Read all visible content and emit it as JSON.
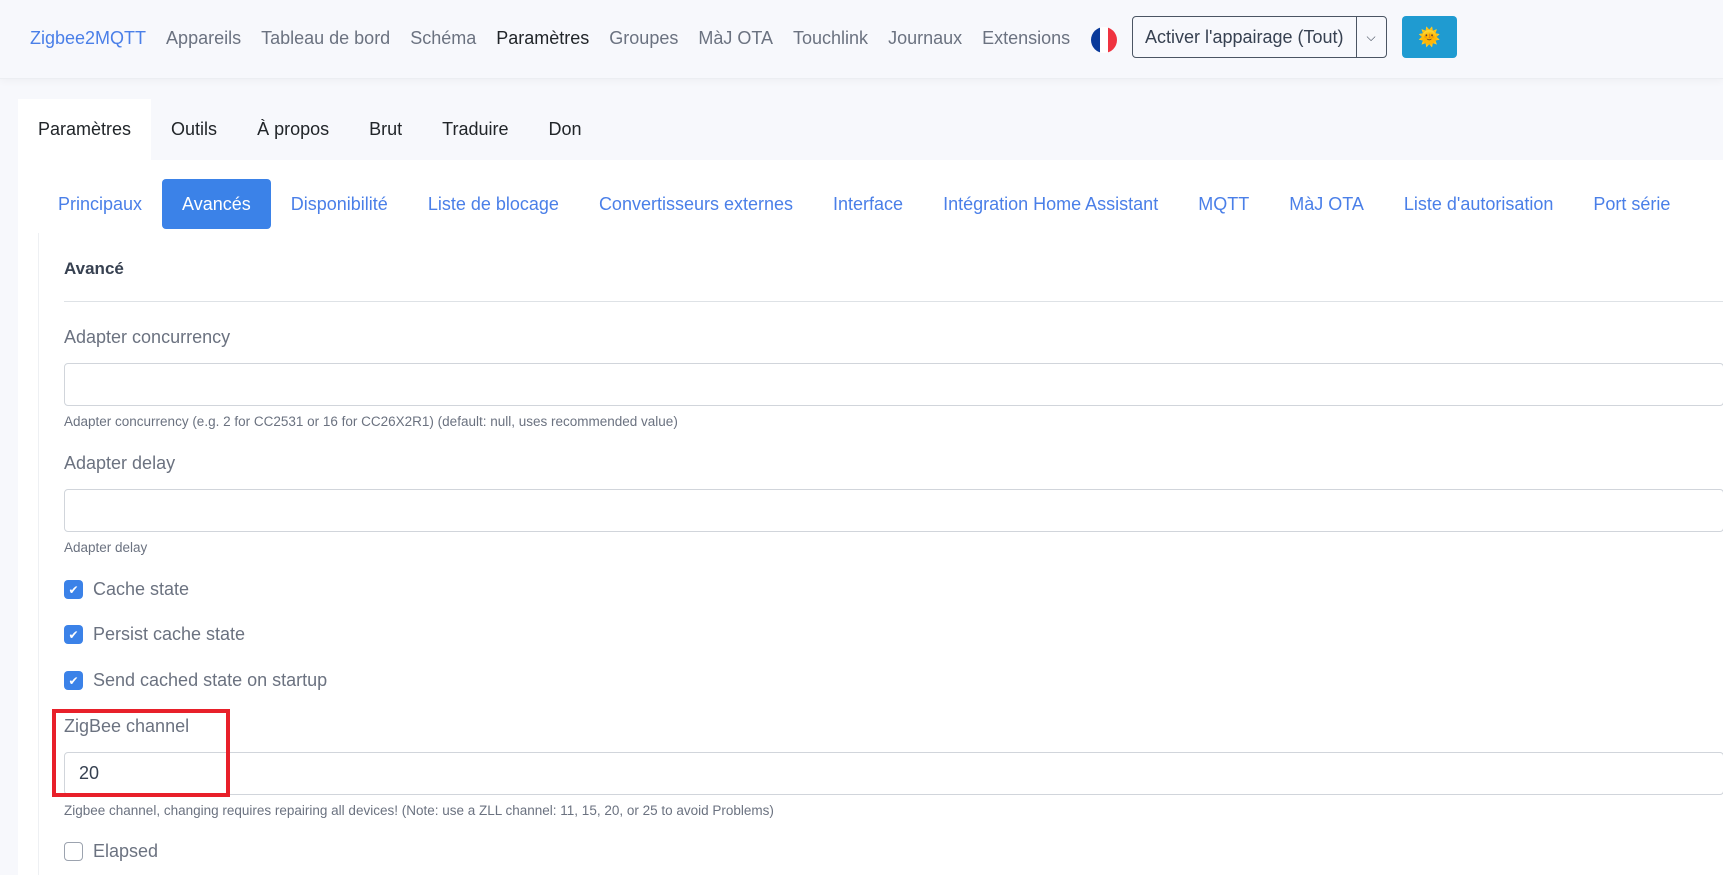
{
  "navbar": {
    "brand": "Zigbee2MQTT",
    "items": [
      "Appareils",
      "Tableau de bord",
      "Schéma",
      "Paramètres",
      "Groupes",
      "MàJ OTA",
      "Touchlink",
      "Journaux",
      "Extensions"
    ],
    "active": "Paramètres",
    "pairing_button": "Activer l'appairage (Tout)",
    "theme_icon": "🌞"
  },
  "tabs": [
    "Paramètres",
    "Outils",
    "À propos",
    "Brut",
    "Traduire",
    "Don"
  ],
  "subtabs": [
    "Principaux",
    "Avancés",
    "Disponibilité",
    "Liste de blocage",
    "Convertisseurs externes",
    "Interface",
    "Intégration Home Assistant",
    "MQTT",
    "MàJ OTA",
    "Liste d'autorisation",
    "Port série"
  ],
  "section": {
    "title": "Avancé",
    "adapter_concurrency": {
      "label": "Adapter concurrency",
      "value": "",
      "help": "Adapter concurrency (e.g. 2 for CC2531 or 16 for CC26X2R1) (default: null, uses recommended value)"
    },
    "adapter_delay": {
      "label": "Adapter delay",
      "value": "",
      "help": "Adapter delay"
    },
    "checkboxes": [
      {
        "label": "Cache state",
        "checked": true
      },
      {
        "label": "Persist cache state",
        "checked": true
      },
      {
        "label": "Send cached state on startup",
        "checked": true
      }
    ],
    "zigbee_channel": {
      "label": "ZigBee channel",
      "value": "20",
      "help": "Zigbee channel, changing requires repairing all devices! (Note: use a ZLL channel: 11, 15, 20, or 25 to avoid Problems)"
    },
    "elapsed": {
      "label": "Elapsed",
      "checked": false
    }
  },
  "colors": {
    "accent": "#3b82e8",
    "highlight": "#e8202a"
  }
}
